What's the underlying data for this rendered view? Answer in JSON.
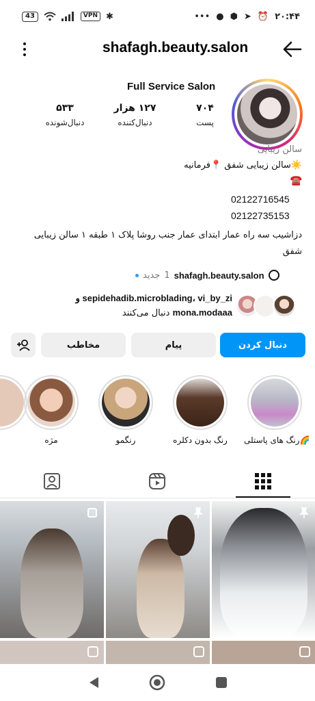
{
  "status_bar": {
    "battery": "43",
    "vpn": "VPN",
    "time": "۲۰:۴۴",
    "dots": "•••"
  },
  "header": {
    "username": "shafagh.beauty.salon"
  },
  "profile": {
    "full_name": "Full Service Salon",
    "stats": [
      {
        "number": "۷۰۴",
        "label": "پست"
      },
      {
        "number": "۱۲۷ هزار",
        "label": "دنبال‌کننده"
      },
      {
        "number": "۵۳۳",
        "label": "دنبال‌شونده"
      }
    ],
    "category": "سالن زیبایی",
    "bio_line1": "☀️سالن زیبایی شفق 📍فرمانیه",
    "bio_phone_icon": "☎️",
    "phone1": "02122716545",
    "phone2": "02122735153",
    "address": "دزاشیب سه راه عمار ابتدای عمار جنب روشا پلاک ۱ طبقه ۱ سالن زیبایی شفق",
    "threads": {
      "name": "shafagh.beauty.salon",
      "new_count": "1",
      "new_label": "جدید"
    },
    "mutual": {
      "users_line": "sepidehadib.microblading، vi_by_zi و",
      "last_user": "mona.modaaa",
      "suffix": "دنبال می‌کنند"
    }
  },
  "buttons": {
    "follow": "دنبال کردن",
    "message": "پیام",
    "contact": "مخاطب"
  },
  "highlights": [
    {
      "label": "رنگ های پاستلی🌈"
    },
    {
      "label": "رنگ بدون دکلره"
    },
    {
      "label": "رنگمو"
    },
    {
      "label": "مژه"
    }
  ],
  "colors": {
    "accent": "#0095f6",
    "ring_gradient": [
      "#feda75",
      "#fa7e1e",
      "#d62976",
      "#962fbf",
      "#4f5bd5"
    ]
  }
}
